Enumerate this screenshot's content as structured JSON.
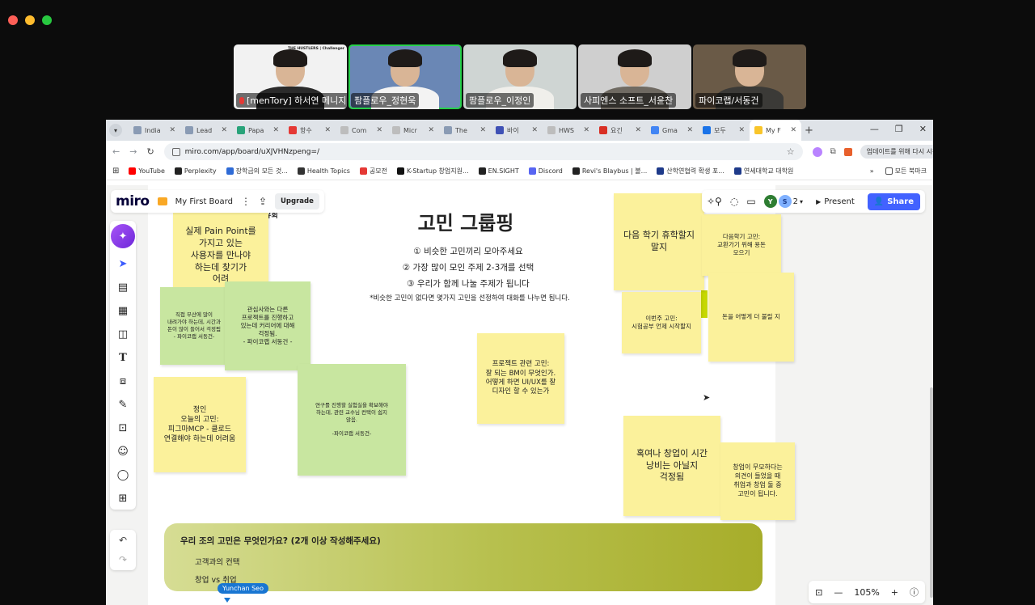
{
  "participants": [
    {
      "name": "[menTory] 하서연 메니지",
      "muted": true,
      "banner": "THE HUSTLERS | Challenger",
      "bg": "#f2f2f2",
      "shirt": "#2b2b2b"
    },
    {
      "name": "팜플로우_정현욱",
      "active": true,
      "bg": "#6a87b5",
      "shirt": "#f3f3f3"
    },
    {
      "name": "팜플로우_이정인",
      "bg": "#cfd5d3",
      "shirt": "#f0efeb"
    },
    {
      "name": "사피엔스 소프트_서윤찬",
      "bg": "#cfcfcf",
      "shirt": "#6f6a62"
    },
    {
      "name": "파이코랩/서동건",
      "bg": "#6a5a47",
      "shirt": "#3b3a37"
    }
  ],
  "tabs": [
    {
      "label": "India",
      "color": "#8a9bb4"
    },
    {
      "label": "Lead",
      "color": "#8a9bb4"
    },
    {
      "label": "Papa",
      "color": "#29a37a"
    },
    {
      "label": "항수",
      "color": "#e53935"
    },
    {
      "label": "Com",
      "color": "#bdbdbd"
    },
    {
      "label": "Micr",
      "color": "#bdbdbd"
    },
    {
      "label": "The",
      "color": "#8a9bb4"
    },
    {
      "label": "바이",
      "color": "#3f51b5"
    },
    {
      "label": "HWS",
      "color": "#bdbdbd"
    },
    {
      "label": "요긴",
      "color": "#d93025"
    },
    {
      "label": "Gma",
      "color": "#4285f4"
    },
    {
      "label": "모두",
      "color": "#1a73e8"
    },
    {
      "label": "My F",
      "color": "#f9c52a",
      "active": true
    }
  ],
  "address": {
    "url": "miro.com/app/board/uXJVHNzpeng=/",
    "update": "업데이트를 위해 다시 시작"
  },
  "bookmarks": [
    {
      "label": "YouTube",
      "color": "#ff0000"
    },
    {
      "label": "Perplexity",
      "color": "#222222"
    },
    {
      "label": "장학금의 모든 것...",
      "color": "#2f6bd6"
    },
    {
      "label": "Health Topics",
      "color": "#333333"
    },
    {
      "label": "공모전",
      "color": "#e53935"
    },
    {
      "label": "K-Startup 창업지원...",
      "color": "#111111"
    },
    {
      "label": "EN.SIGHT",
      "color": "#222222"
    },
    {
      "label": "Discord",
      "color": "#5865f2"
    },
    {
      "label": "Revi's Blaybus | 볼...",
      "color": "#222222"
    },
    {
      "label": "산학연협력 확생 포...",
      "color": "#1e3a8a"
    },
    {
      "label": "연세대학교 대학원",
      "color": "#1e3a8a"
    }
  ],
  "bookmarks_right": {
    "more": "»",
    "all": "모든 북마크"
  },
  "miro": {
    "logo": "miro",
    "board_name": "My First Board",
    "upgrade": "Upgrade",
    "avatar_count": "2",
    "avatar_letters": [
      "Y",
      "S"
    ],
    "present": "Present",
    "share": "Share",
    "zoom": "105%"
  },
  "board": {
    "title": "고민 그룹핑",
    "steps": [
      "① 비슷한 고민끼리 모아주세요",
      "② 가장 많이 모인 주제 2-3개를 선택",
      "③ 우리가 함께 나눌 주제가 됩니다"
    ],
    "note": "*비슷한 고민이 없다면 몇가지 고민을 선정하여 대화를 나누면 됩니다.",
    "fragment": "공유회",
    "stickies": [
      {
        "text": "실제 Pain Point를\n가지고 있는\n사용자를 만나야\n하는데 찾기가\n어려"
      },
      {
        "text": "직접 부산에 많이\n내려가야 하는데, 시간과\n돈이 많이 들어서 걱정됨\n- 파이코랩 서동건-"
      },
      {
        "text": "관심사와는 다른\n프로젝트를 진행하고\n있는데 커리어에 대해\n걱정됨.\n- 파이코랩 서동건 -"
      },
      {
        "text": "정인\n오늘의 고민:\n피그마MCP - 클로드\n연결해야 하는데 어려움"
      },
      {
        "text": "연구를 진행할 실험실을 확보해야\n하는데, 관련 교수님 컨택이 쉽지\n않음.\n\n-파이코랩 서동건-"
      },
      {
        "text": "프로젝트 관련 고민:\n잘 되는 BM이 무엇인가.\n어떻게 하면 UI/UX를 잘\n디자인 할 수 있는가"
      },
      {
        "text": "다음 학기 휴학할지\n말지"
      },
      {
        "text": "다음학기 고민:\n교환가기 위해 용돈\n모으기"
      },
      {
        "text": "이번주 고민:\n시험공부 언제 시작할지"
      },
      {
        "text": "돈을 어떻게 더 불릴 지"
      },
      {
        "text": "혹여나 창업이 시간\n낭비는 아닐지\n걱정됨"
      },
      {
        "text": "창업이 무모하다는\n의견이 들었을 때\n취업과 창업 둘 중\n고민이 됩니다."
      }
    ],
    "bottom_question": "우리 조의 고민은 무엇인가요? (2개 이상 작성해주세요)",
    "bottom_items": [
      "고객과의 컨택",
      "창업 vs 취업"
    ],
    "cursor_user": "Yunchan Seo"
  }
}
